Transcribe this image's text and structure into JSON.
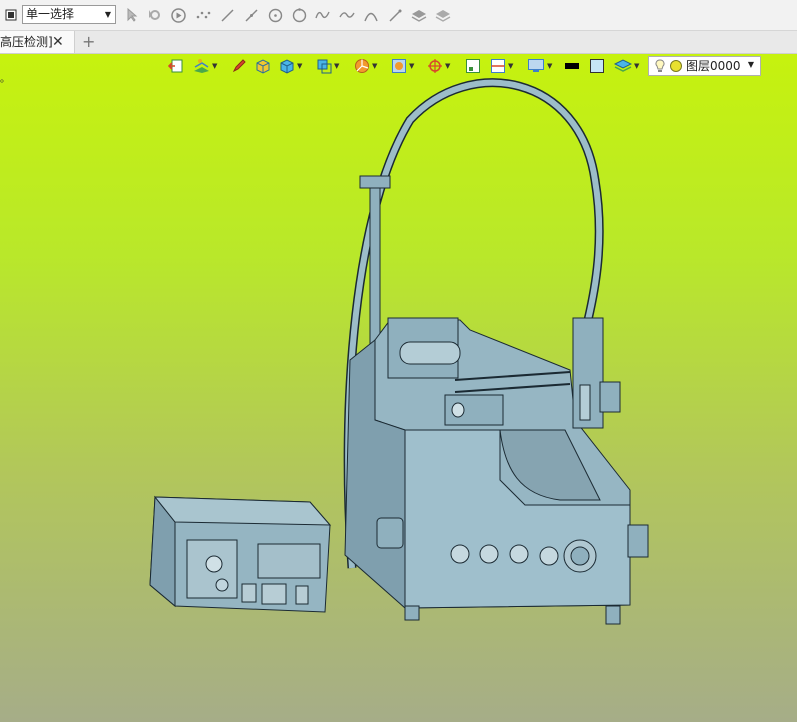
{
  "toolbar": {
    "selection_mode": "单一选择"
  },
  "tabs": [
    {
      "label": "高压检测]",
      "close": "✕"
    }
  ],
  "tab_add": "+",
  "view_toolbar": {
    "layer_label": "图层0000"
  },
  "left_marker": "。",
  "colors": {
    "viewport_top": "#c6f20e",
    "viewport_bottom": "#a6ad88",
    "model": "#8fb0be",
    "model_edges": "#1b2a33"
  },
  "icons": [
    "stop-icon",
    "pointer-icon",
    "gear-pointer-icon",
    "play-icon",
    "dots-icon",
    "line-icon",
    "line2-icon",
    "circle-icon",
    "circle2-icon",
    "wave-icon",
    "wave2-icon",
    "arc-icon",
    "pen-icon",
    "stack-icon",
    "stack2-icon",
    "exit-view-icon",
    "layers-view-icon",
    "pencil-icon",
    "box-yellow-icon",
    "box-blue-icon",
    "box-wire-icon",
    "pie-icon",
    "frame-icon",
    "target-icon",
    "rect-view-icon",
    "split-view-icon",
    "monitor-icon",
    "black-bar-icon",
    "blue-square-icon",
    "layer-stack-icon",
    "bulb-icon",
    "sun-icon"
  ]
}
